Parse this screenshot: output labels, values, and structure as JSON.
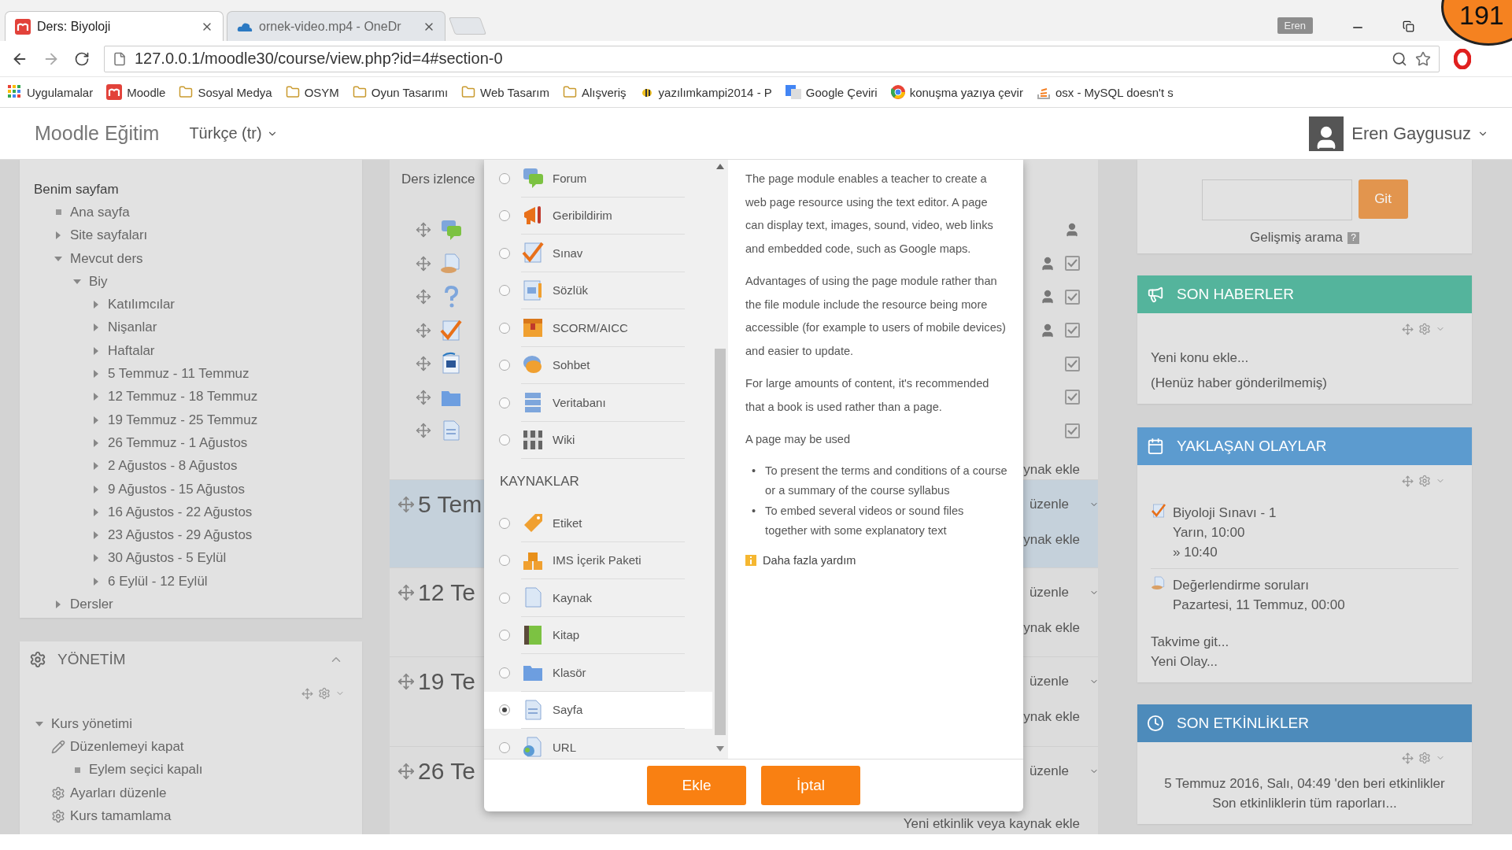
{
  "browser": {
    "tabs": [
      {
        "title": "Ders: Biyoloji",
        "selected": true
      },
      {
        "title": "ornek-video.mp4 - OneDr",
        "selected": false
      }
    ],
    "profile": "Eren",
    "badge": "191",
    "url": "127.0.0.1/moodle30/course/view.php?id=4#section-0",
    "bookmarks": [
      {
        "label": "Uygulamalar",
        "kind": "apps"
      },
      {
        "label": "Moodle",
        "kind": "moodle"
      },
      {
        "label": "Sosyal Medya",
        "kind": "folder"
      },
      {
        "label": "OSYM",
        "kind": "folder"
      },
      {
        "label": "Oyun Tasarımı",
        "kind": "folder"
      },
      {
        "label": "Web Tasarım",
        "kind": "folder"
      },
      {
        "label": "Alışveriş",
        "kind": "folder"
      },
      {
        "label": "yazılımkampi2014 - P",
        "kind": "bee"
      },
      {
        "label": "Google Çeviri",
        "kind": "translate"
      },
      {
        "label": "konuşma yazıya çevir",
        "kind": "google"
      },
      {
        "label": "osx - MySQL doesn't s",
        "kind": "stack"
      }
    ]
  },
  "navbar": {
    "brand": "Moodle Eğitim",
    "language": "Türkçe (tr)",
    "user": "Eren Gaygusuz"
  },
  "navigation": {
    "items": [
      {
        "label": "Benim sayfam",
        "kind": "root",
        "children": [
          {
            "label": "Ana sayfa",
            "kind": "leaf"
          },
          {
            "label": "Site sayfaları",
            "kind": "branch",
            "expanded": false
          },
          {
            "label": "Mevcut ders",
            "kind": "branch",
            "expanded": true,
            "children": [
              {
                "label": "Biy",
                "kind": "branch",
                "expanded": true,
                "children": [
                  {
                    "label": "Katılımcılar",
                    "kind": "branch",
                    "expanded": false
                  },
                  {
                    "label": "Nişanlar",
                    "kind": "branch",
                    "expanded": false
                  },
                  {
                    "label": "Haftalar",
                    "kind": "branch",
                    "expanded": false
                  },
                  {
                    "label": "5 Temmuz - 11 Temmuz",
                    "kind": "branch",
                    "expanded": false
                  },
                  {
                    "label": "12 Temmuz - 18 Temmuz",
                    "kind": "branch",
                    "expanded": false
                  },
                  {
                    "label": "19 Temmuz - 25 Temmuz",
                    "kind": "branch",
                    "expanded": false
                  },
                  {
                    "label": "26 Temmuz - 1 Ağustos",
                    "kind": "branch",
                    "expanded": false
                  },
                  {
                    "label": "2 Ağustos - 8 Ağustos",
                    "kind": "branch",
                    "expanded": false
                  },
                  {
                    "label": "9 Ağustos - 15 Ağustos",
                    "kind": "branch",
                    "expanded": false
                  },
                  {
                    "label": "16 Ağustos - 22 Ağustos",
                    "kind": "branch",
                    "expanded": false
                  },
                  {
                    "label": "23 Ağustos - 29 Ağustos",
                    "kind": "branch",
                    "expanded": false
                  },
                  {
                    "label": "30 Ağustos - 5 Eylül",
                    "kind": "branch",
                    "expanded": false
                  },
                  {
                    "label": "6 Eylül - 12 Eylül",
                    "kind": "branch",
                    "expanded": false
                  }
                ]
              }
            ]
          },
          {
            "label": "Dersler",
            "kind": "branch",
            "expanded": false
          }
        ]
      }
    ]
  },
  "administration": {
    "title": "YÖNETİM",
    "items": [
      {
        "label": "Kurs yönetimi",
        "kind": "branch",
        "expanded": true,
        "children": [
          {
            "label": "Düzenlemeyi kapat",
            "kind": "edit",
            "children": [
              {
                "label": "Eylem seçici kapalı",
                "kind": "leaf"
              }
            ]
          },
          {
            "label": "Ayarları düzenle",
            "kind": "settings"
          },
          {
            "label": "Kurs tamamlama",
            "kind": "settings"
          }
        ]
      }
    ]
  },
  "course": {
    "first_section": {
      "title": "Ders izlence",
      "add_link": "ynak ekle",
      "activities": [
        {
          "kind": "forum",
          "group_mode": true
        },
        {
          "kind": "assign",
          "group_mode": true,
          "completion": {
            "checked": true
          }
        },
        {
          "kind": "question",
          "group_mode": true,
          "completion": {
            "checked": true
          }
        },
        {
          "kind": "quiz",
          "group_mode": true,
          "completion": {
            "checked": true
          }
        },
        {
          "kind": "word",
          "group_mode": false,
          "completion": {
            "checked": true
          }
        },
        {
          "kind": "folder",
          "group_mode": false,
          "completion": {
            "checked": true
          }
        },
        {
          "kind": "page",
          "group_mode": false,
          "completion": {
            "checked": true
          }
        }
      ]
    },
    "sections": [
      {
        "title": "5 Tem",
        "highlighted": true,
        "edit": "üzenle",
        "add_link": "ynak ekle"
      },
      {
        "title": "12 Te",
        "highlighted": false,
        "edit": "üzenle",
        "add_link": "ynak ekle"
      },
      {
        "title": "19 Te",
        "highlighted": false,
        "edit": "üzenle",
        "add_link": "ynak ekle"
      },
      {
        "title": "26 Te",
        "highlighted": false,
        "edit": "üzenle",
        "add_link": "Yeni etkinlik veya kaynak ekle"
      }
    ]
  },
  "module_chooser": {
    "groups": [
      {
        "items": [
          {
            "label": "Forum",
            "selected": false
          },
          {
            "label": "Geribildirim",
            "selected": false
          },
          {
            "label": "Sınav",
            "selected": false
          },
          {
            "label": "Sözlük",
            "selected": false
          },
          {
            "label": "SCORM/AICC",
            "selected": false
          },
          {
            "label": "Sohbet",
            "selected": false
          },
          {
            "label": "Veritabanı",
            "selected": false
          },
          {
            "label": "Wiki",
            "selected": false
          }
        ]
      },
      {
        "heading": "KAYNAKLAR",
        "items": [
          {
            "label": "Etiket",
            "selected": false
          },
          {
            "label": "IMS İçerik Paketi",
            "selected": false
          },
          {
            "label": "Kaynak",
            "selected": false
          },
          {
            "label": "Kitap",
            "selected": false
          },
          {
            "label": "Klasör",
            "selected": false
          },
          {
            "label": "Sayfa",
            "selected": true
          },
          {
            "label": "URL",
            "selected": false
          }
        ]
      }
    ],
    "help": {
      "paragraphs": [
        "The page module enables a teacher to create a web page resource using the text editor. A page can display text, images, sound, video, web links and embedded code, such as Google maps.",
        "Advantages of using the page module rather than the file module include the resource being more accessible (for example to users of mobile devices) and easier to update.",
        "For large amounts of content, it's recommended that a book is used rather than a page.",
        "A page may be used"
      ],
      "bullets": [
        {
          "marker": "•",
          "text": "To present the terms and conditions of a course or a summary of the course syllabus"
        },
        {
          "marker": "•",
          "text": "To embed several videos or sound files together with some explanatory text"
        }
      ],
      "more_link": "Daha fazla yardım"
    },
    "buttons": [
      "Ekle",
      "İptal"
    ]
  },
  "search": {
    "button": "Git",
    "advanced_link": "Gelişmiş arama",
    "help_mark": "?"
  },
  "news": {
    "title": "SON HABERLER",
    "links": [
      "Yeni konu ekle...",
      "(Henüz haber gönderilmemiş)"
    ]
  },
  "events": {
    "title": "YAKLAŞAN OLAYLAR",
    "items": [
      {
        "kind": "quiz",
        "lines": [
          "Biyoloji Sınavı - 1",
          "Yarın, 10:00",
          "» 10:40"
        ]
      },
      {
        "kind": "assign",
        "lines": [
          "Değerlendirme soruları",
          "Pazartesi, 11 Temmuz, 00:00"
        ]
      }
    ],
    "links": [
      "Takvime git...",
      "Yeni Olay..."
    ]
  },
  "recent": {
    "title": "SON ETKİNLİKLER",
    "lines": [
      "5 Temmuz 2016, Salı, 04:49 'den beri etkinlikler",
      "Son etkinliklerin tüm raporları..."
    ]
  }
}
